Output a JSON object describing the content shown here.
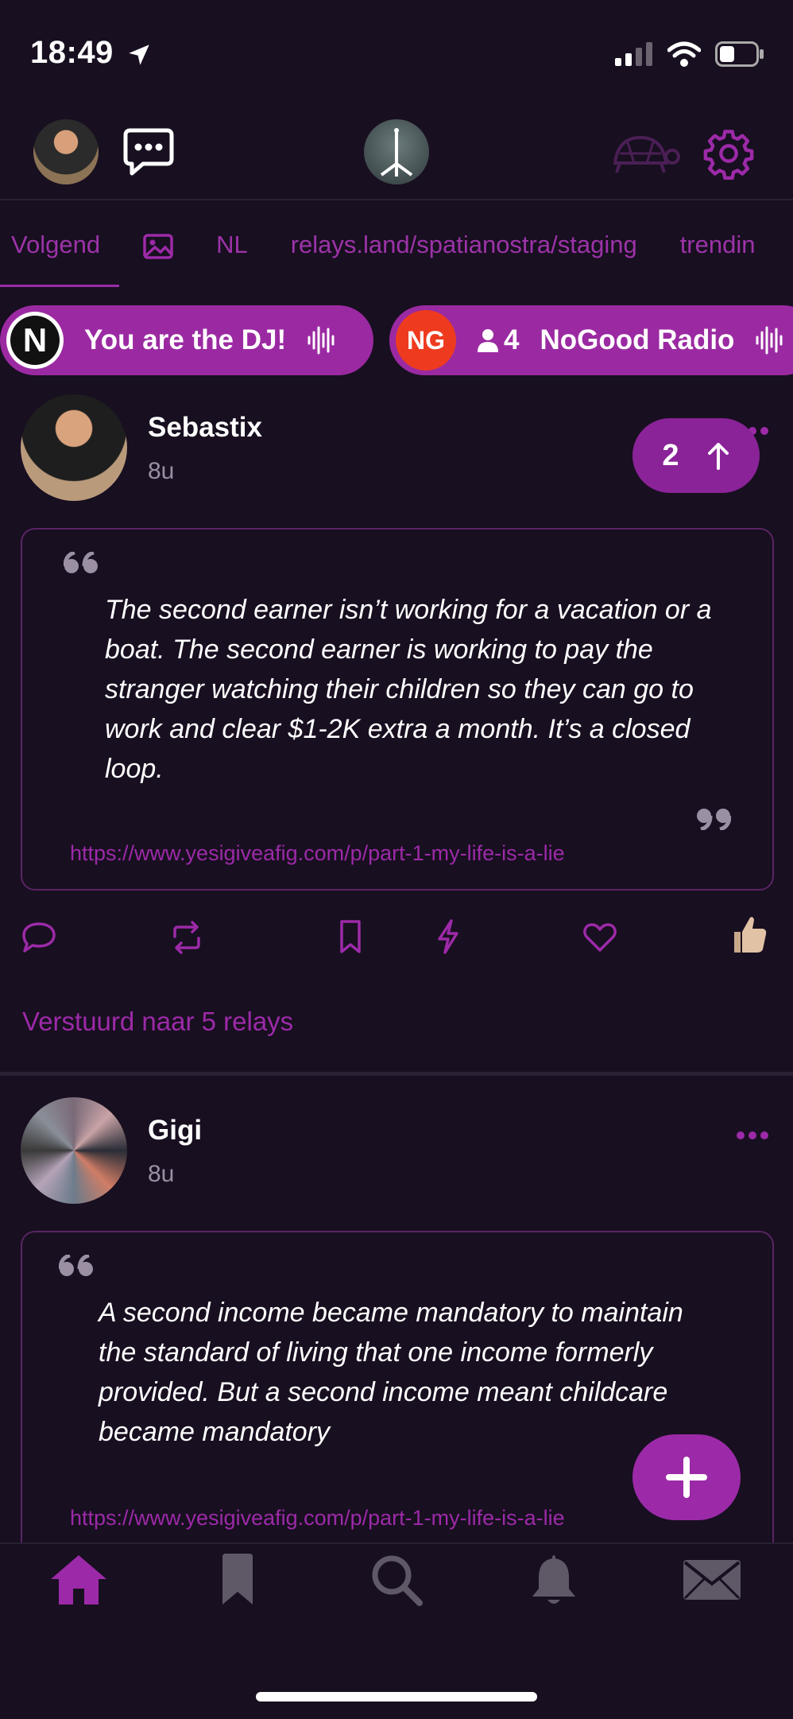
{
  "status_bar": {
    "time": "18:49"
  },
  "tabs": [
    "Volgend",
    "NL",
    "relays.land/spatianostra/staging",
    "trendin"
  ],
  "dj_pills": [
    {
      "label": "You are the DJ!",
      "logo_text": "N"
    },
    {
      "label": "NoGood Radio",
      "logo_text": "NG",
      "listeners": "4"
    }
  ],
  "posts": [
    {
      "author": "Sebastix",
      "time": "8u",
      "quote": "The second earner isn’t working for a vacation or a boat. The second earner is working to pay the stranger watching their children so they can go to work and clear $1-2K extra a month. It’s a closed loop.",
      "link": "https://www.yesigiveafig.com/p/part-1-my-life-is-a-lie",
      "upvote_count": "2",
      "sent_text": "Verstuurd naar 5 relays"
    },
    {
      "author": "Gigi",
      "time": "8u",
      "quote": "A second income became mandatory to maintain the standard of living that one income formerly provided. But a second income meant childcare became mandatory",
      "link": "https://www.yesigiveafig.com/p/part-1-my-life-is-a-lie"
    }
  ],
  "colors": {
    "accent": "#9c2aa8",
    "background": "#180f20",
    "pill": "#9b2aa2"
  },
  "icons": [
    "location-arrow-icon",
    "signal-icon",
    "wifi-icon",
    "battery-icon",
    "chat-icon",
    "turtle-icon",
    "gear-icon",
    "image-icon",
    "audio-wave-icon",
    "person-icon",
    "arrow-up-icon",
    "reply-icon",
    "repost-icon",
    "bookmark-icon",
    "zap-icon",
    "heart-icon",
    "thumbs-up-icon",
    "more-icon",
    "plus-icon",
    "home-icon",
    "search-icon",
    "bell-icon",
    "mail-icon"
  ]
}
